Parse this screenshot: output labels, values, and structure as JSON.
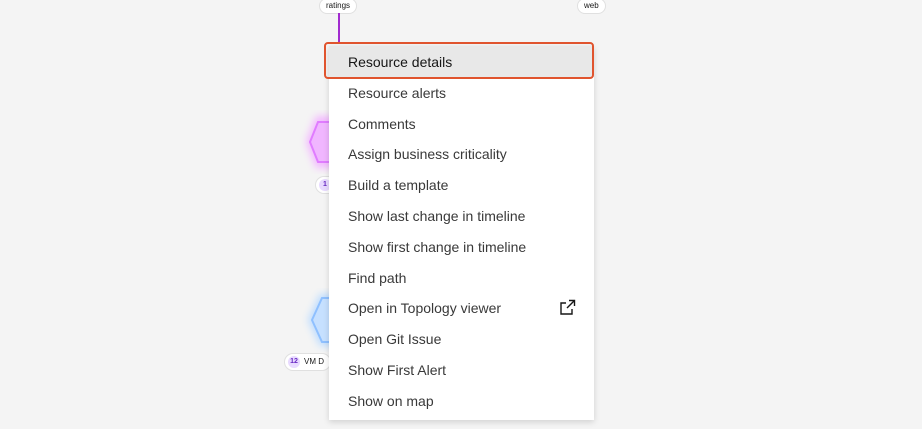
{
  "graph": {
    "nodes": [
      {
        "label": "ratings"
      },
      {
        "label": "web"
      }
    ],
    "badges": [
      {
        "count": "1",
        "label": ""
      },
      {
        "count": "12",
        "label": "VM D"
      }
    ]
  },
  "context_menu": {
    "items": [
      {
        "label": "Resource details",
        "selected": true
      },
      {
        "label": "Resource alerts"
      },
      {
        "label": "Comments"
      },
      {
        "label": "Assign business criticality"
      },
      {
        "label": "Build a template"
      },
      {
        "label": "Show last change in timeline"
      },
      {
        "label": "Show first change in timeline"
      },
      {
        "label": "Find path"
      },
      {
        "label": "Open in Topology viewer",
        "icon": "external-link-icon"
      },
      {
        "label": "Open Git Issue"
      },
      {
        "label": "Show First Alert"
      },
      {
        "label": "Show on map"
      }
    ]
  },
  "colors": {
    "highlight": "#e0542e",
    "edge": "#a12bcf",
    "node_purple": "#f0b6ff",
    "node_blue": "#b6d8ff"
  }
}
